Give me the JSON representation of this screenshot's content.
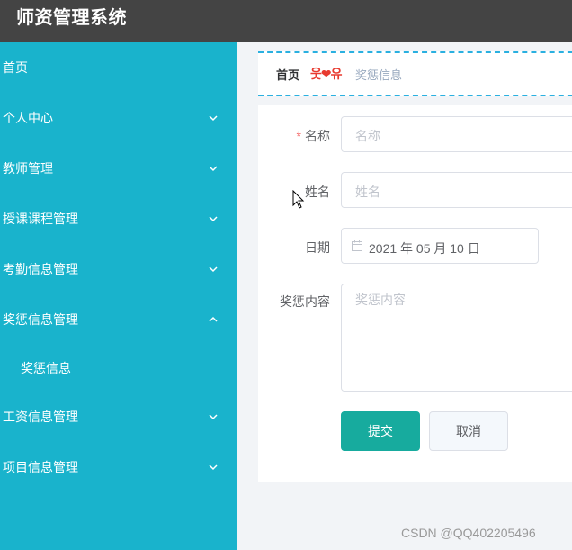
{
  "app": {
    "title": "师资管理系统"
  },
  "sidebar": {
    "items": [
      {
        "label": "首页",
        "has_arrow": false
      },
      {
        "label": "个人中心",
        "has_arrow": true,
        "expanded": false
      },
      {
        "label": "教师管理",
        "has_arrow": true,
        "expanded": false
      },
      {
        "label": "授课课程管理",
        "has_arrow": true,
        "expanded": false
      },
      {
        "label": "考勤信息管理",
        "has_arrow": true,
        "expanded": false
      },
      {
        "label": "奖惩信息管理",
        "has_arrow": true,
        "expanded": true
      },
      {
        "label": "奖惩信息",
        "sub": true
      },
      {
        "label": "工资信息管理",
        "has_arrow": true,
        "expanded": false
      },
      {
        "label": "项目信息管理",
        "has_arrow": true,
        "expanded": false
      }
    ]
  },
  "breadcrumb": {
    "home": "首页",
    "separator": "웃❤유",
    "current": "奖惩信息"
  },
  "form": {
    "name": {
      "label": "名称",
      "required_mark": "*",
      "placeholder": "名称"
    },
    "person": {
      "label": "姓名",
      "placeholder": "姓名"
    },
    "date": {
      "label": "日期",
      "value": "2021 年 05 月 10 日"
    },
    "content": {
      "label": "奖惩内容",
      "placeholder": "奖惩内容"
    },
    "submit_label": "提交",
    "cancel_label": "取消"
  },
  "watermark": "CSDN @QQ402205496",
  "colors": {
    "header_bg": "#444444",
    "sidebar_bg": "#19b3cc",
    "primary_button": "#17ab9e",
    "breadcrumb_border": "#2ab0e0",
    "separator": "#e83a2f"
  }
}
